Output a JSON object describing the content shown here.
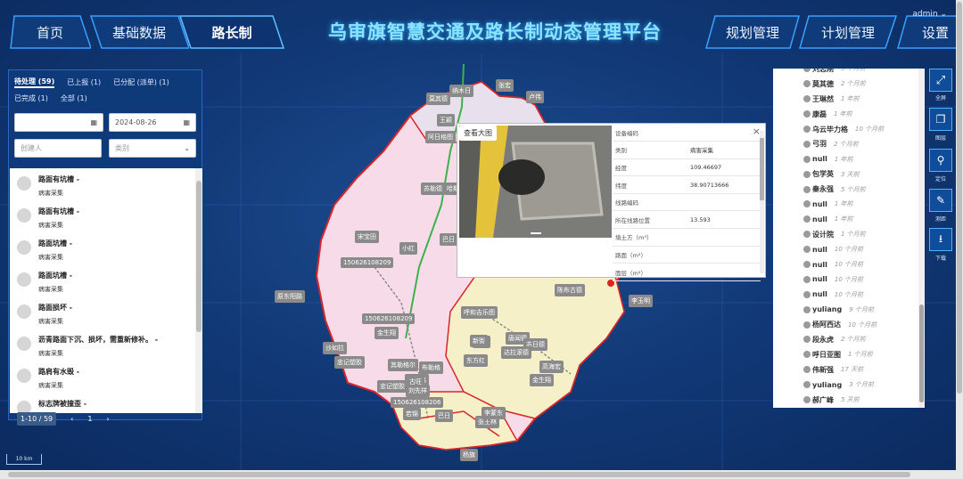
{
  "header": {
    "title": "乌审旗智慧交通及路长制动态管理平台",
    "user": "admin ⌄",
    "nav_left": [
      "首页",
      "基础数据",
      "路长制"
    ],
    "nav_right": [
      "规划管理",
      "计划管理",
      "设置"
    ]
  },
  "left_panel": {
    "tabs_row1": [
      "待处理 (59)",
      "已上报 (1)",
      "已分配 (派单) (1)"
    ],
    "tabs_row2": [
      "已完成 (1)",
      "全部 (1)"
    ],
    "date_from": "",
    "date_to": "2024-08-26",
    "creator_placeholder": "创建人",
    "category_placeholder": "类别",
    "items": [
      {
        "title": "路面有坑槽 -",
        "sub": "病害采集"
      },
      {
        "title": "路面有坑槽 -",
        "sub": "病害采集"
      },
      {
        "title": "路面坑槽 -",
        "sub": "病害采集"
      },
      {
        "title": "路面坑槽 -",
        "sub": "病害采集"
      },
      {
        "title": "路面损坏 -",
        "sub": "病害采集"
      },
      {
        "title": "沥青路面下沉、损坏，需重新修补。 -",
        "sub": "病害采集"
      },
      {
        "title": "路肩有水毁 -",
        "sub": "病害采集"
      },
      {
        "title": "标志牌被撞歪 -",
        "sub": ""
      }
    ],
    "pager": {
      "range": "1-10 / 59",
      "prev": "‹",
      "page": "1",
      "next": "›"
    }
  },
  "map": {
    "labels": [
      "莫其德",
      "纳木日",
      "张宏",
      "卢伟",
      "王颖",
      "阿日格图",
      "查看大图",
      "苏勒德",
      "哈斯",
      "巴日",
      "宋宝田",
      "小红",
      "150626108209",
      "原东阳路",
      "150626108209",
      "金生翔",
      "沙如拉",
      "忠记塑胶",
      "其勒格尔",
      "布勒格",
      "阿日格",
      "东方红",
      "巴日",
      "忠记塑胶",
      "古旺",
      "刘先祥",
      "150626108206",
      "若锦",
      "张王林",
      "李蒙东",
      "唐闻德",
      "金生翔",
      "高海宏",
      "苏日德",
      "呼和吉乐图",
      "阿拉",
      "陈布古德",
      "李玉明",
      "新街",
      "达拉滚德",
      "杨旗"
    ],
    "scale": "10 km"
  },
  "popup": {
    "view_big": "查看大图",
    "fields": [
      {
        "k": "设备编码",
        "v": ""
      },
      {
        "k": "类别",
        "v": "病害采集"
      },
      {
        "k": "经度",
        "v": "109.46697"
      },
      {
        "k": "纬度",
        "v": "38.90713666"
      },
      {
        "k": "线路编码",
        "v": ""
      },
      {
        "k": "所在线路位置",
        "v": "13.593"
      },
      {
        "k": "填土方（m³）",
        "v": ""
      },
      {
        "k": "路面（m²）",
        "v": ""
      },
      {
        "k": "面层（m²）",
        "v": ""
      }
    ]
  },
  "right_panel": {
    "items": [
      {
        "name": "刘志刚",
        "time": "3 个月前"
      },
      {
        "name": "莫其德",
        "time": "2 个月前"
      },
      {
        "name": "王琳然",
        "time": "1 年前"
      },
      {
        "name": "康磊",
        "time": "1 年前"
      },
      {
        "name": "乌云毕力格",
        "time": "10 个月前"
      },
      {
        "name": "弓羽",
        "time": "2 个月前"
      },
      {
        "name": "null",
        "time": "1 年前"
      },
      {
        "name": "包学英",
        "time": "3 天前"
      },
      {
        "name": "秦永强",
        "time": "5 个月前"
      },
      {
        "name": "null",
        "time": "1 年前"
      },
      {
        "name": "null",
        "time": "1 年前"
      },
      {
        "name": "设计院",
        "time": "1 个月前"
      },
      {
        "name": "null",
        "time": "10 个月前"
      },
      {
        "name": "null",
        "time": "10 个月前"
      },
      {
        "name": "null",
        "time": "10 个月前"
      },
      {
        "name": "null",
        "time": "10 个月前"
      },
      {
        "name": "yuliang",
        "time": "9 个月前"
      },
      {
        "name": "杨阿西达",
        "time": "10 个月前"
      },
      {
        "name": "段永虎",
        "time": "2 个月前"
      },
      {
        "name": "呼日亚图",
        "time": "1 个月前"
      },
      {
        "name": "伟新强",
        "time": "17 天前"
      },
      {
        "name": "yuliang",
        "time": "3 个月前"
      },
      {
        "name": "郝广峰",
        "time": "5 天前"
      }
    ]
  },
  "tools": [
    {
      "label": "全屏",
      "icon": "expand-icon"
    },
    {
      "label": "图层",
      "icon": "layers-icon"
    },
    {
      "label": "定位",
      "icon": "location-icon"
    },
    {
      "label": "测距",
      "icon": "ruler-icon"
    },
    {
      "label": "下载",
      "icon": "download-icon"
    }
  ]
}
